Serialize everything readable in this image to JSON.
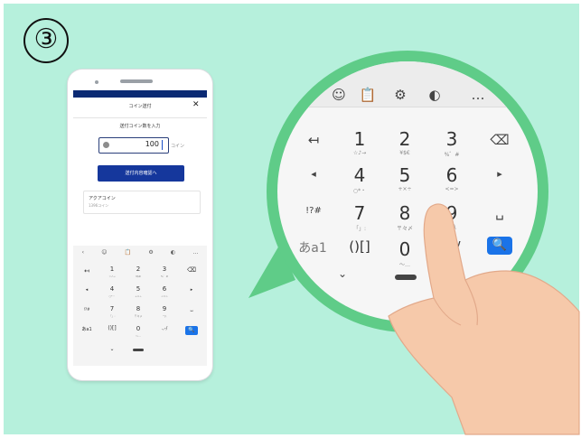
{
  "step_number": "③",
  "colors": {
    "background": "#b6f0dc",
    "accent_navy": "#0b2a74",
    "primary_button": "#15379c",
    "search_key": "#1a73e8",
    "bubble": "#5fcc88",
    "skin": "#f6c9aa"
  },
  "phone": {
    "header_title": "コイン送付",
    "close_label": "✕",
    "prompt": "送付コイン数を入力",
    "amount_value": "100",
    "amount_unit": "コイン",
    "coin_icon": "coin-icon",
    "confirm_button": "送付内容確認へ",
    "coin_card": {
      "name": "アクアコイン",
      "balance": "1396コイン"
    },
    "keyboard": {
      "toolbar": [
        "‹",
        "☺",
        "📋",
        "⚙",
        "◐",
        "…"
      ],
      "rows": [
        {
          "left": "↤",
          "keys": [
            {
              "k": "1",
              "s": "☆♪→"
            },
            {
              "k": "2",
              "s": "¥$€"
            },
            {
              "k": "3",
              "s": "%゜#"
            }
          ],
          "right": "⌫"
        },
        {
          "left": "◂",
          "keys": [
            {
              "k": "4",
              "s": "○*・"
            },
            {
              "k": "5",
              "s": "+×÷"
            },
            {
              "k": "6",
              "s": "<=>"
            }
          ],
          "right": "▸"
        },
        {
          "left": "!?#",
          "keys": [
            {
              "k": "7",
              "s": "「」:"
            },
            {
              "k": "8",
              "s": "〒々〆"
            },
            {
              "k": "9",
              "s": "^|\\"
            }
          ],
          "right": "␣"
        },
        {
          "left": "あa1",
          "keys": [
            {
              "k": "()[]",
              "s": ""
            },
            {
              "k": "0",
              "s": "〜…"
            },
            {
              "k": ".,-/",
              "s": ""
            }
          ],
          "right": "🔍"
        }
      ],
      "bottom": {
        "hide": "⌄",
        "bar": "▬"
      }
    }
  },
  "magnifier": {
    "toolbar": [
      "☺",
      "📋",
      "⚙",
      "◐",
      "…"
    ],
    "rows": [
      {
        "left": "↤",
        "keys": [
          {
            "k": "1",
            "s": "☆♪→"
          },
          {
            "k": "2",
            "s": "¥$€"
          },
          {
            "k": "3",
            "s": "%゜#"
          }
        ],
        "right": "⌫"
      },
      {
        "left": "◂",
        "keys": [
          {
            "k": "4",
            "s": "○*・"
          },
          {
            "k": "5",
            "s": "+×÷"
          },
          {
            "k": "6",
            "s": "<=>"
          }
        ],
        "right": "▸"
      },
      {
        "left": "!?#",
        "keys": [
          {
            "k": "7",
            "s": "「」:"
          },
          {
            "k": "8",
            "s": "〒々〆"
          },
          {
            "k": "9",
            "s": "^|\\"
          }
        ],
        "right": "␣"
      },
      {
        "left": "あa1",
        "keys": [
          {
            "k": "()[]",
            "s": ""
          },
          {
            "k": "0",
            "s": "〜…"
          },
          {
            "k": "/",
            "s": ""
          }
        ],
        "right": "🔍"
      }
    ],
    "bottom": {
      "hide": "⌄",
      "bar": "▬"
    }
  }
}
